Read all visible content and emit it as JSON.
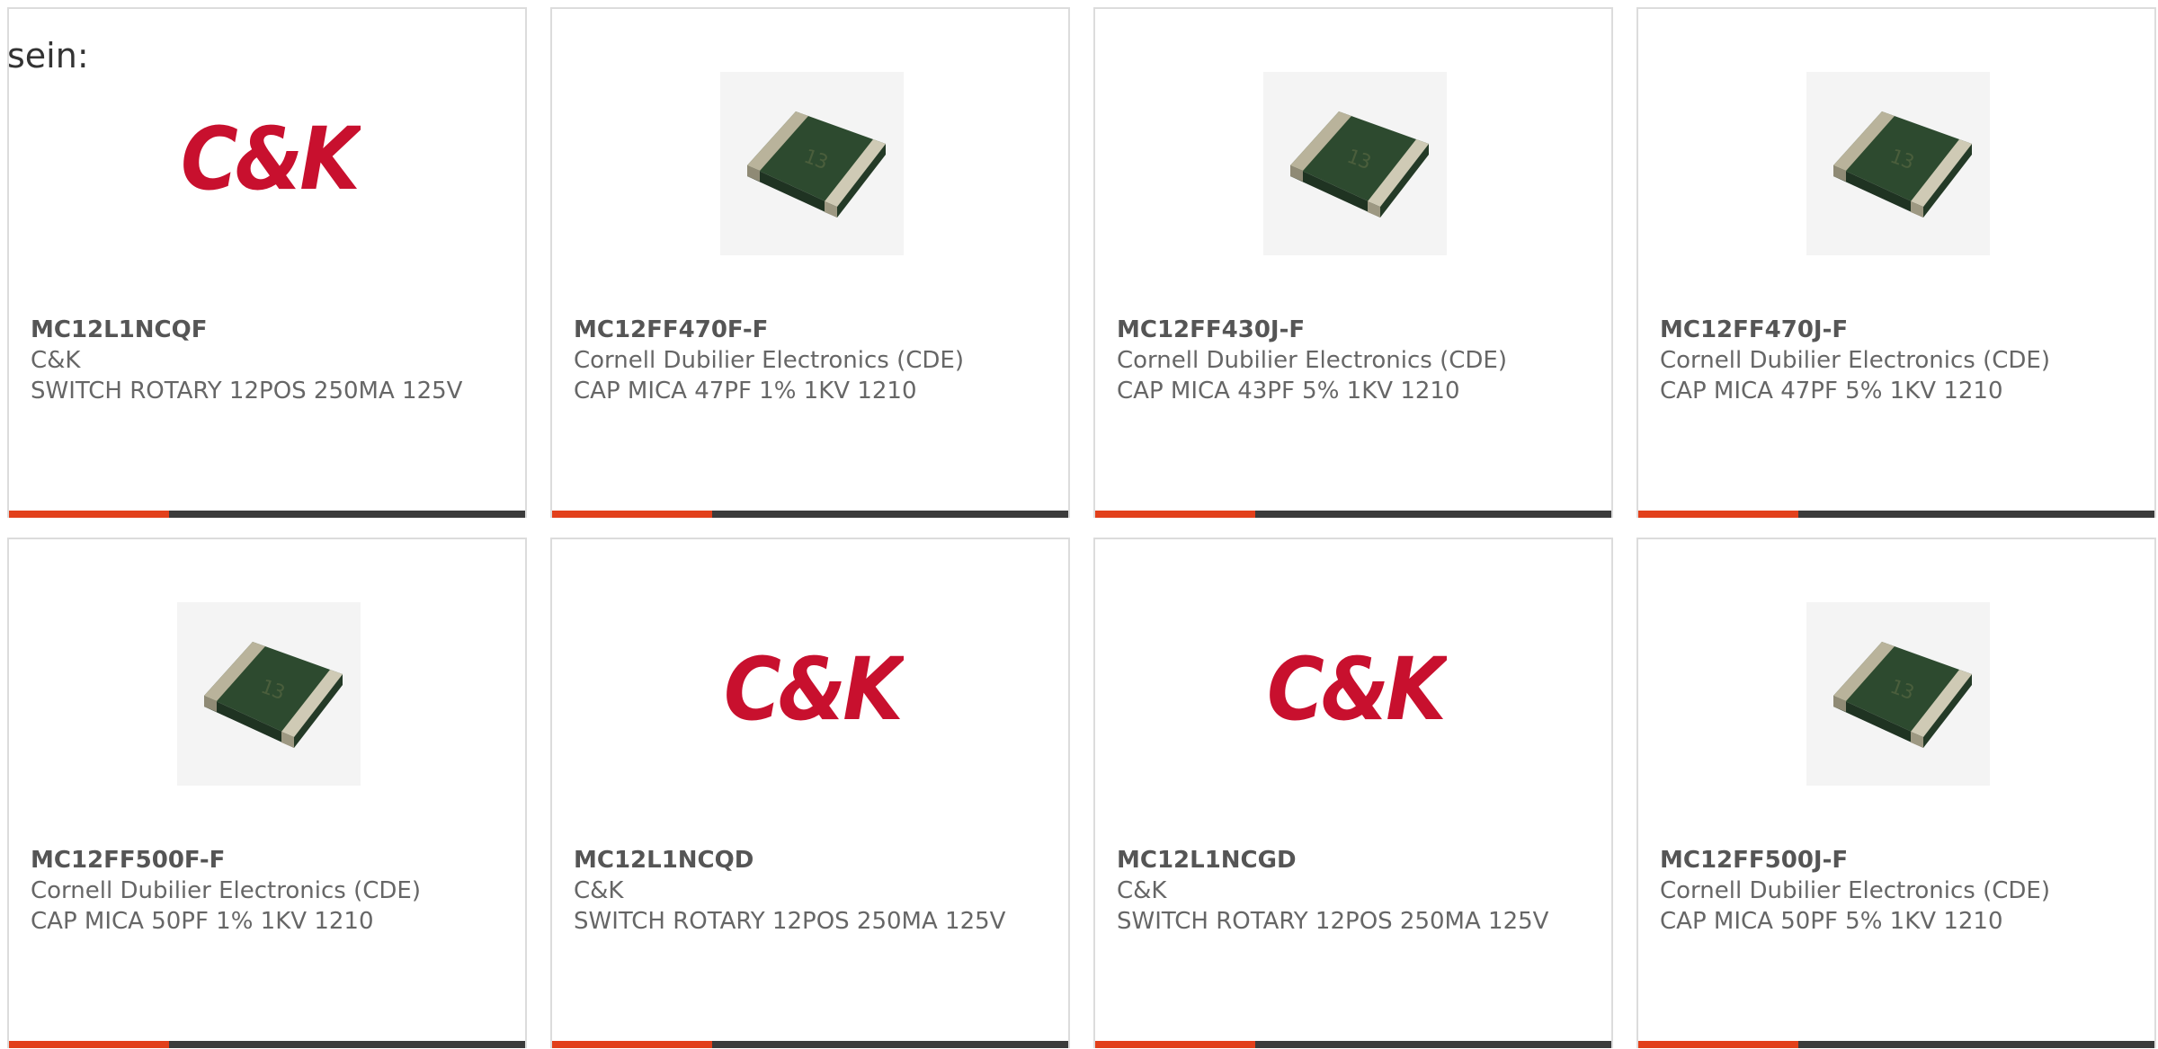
{
  "intro_text": "sein:",
  "colors": {
    "accent": "#e2401b",
    "bar": "#3b3b3b",
    "logo_red": "#c8102e"
  },
  "accent_fraction": 0.31,
  "products": [
    {
      "part": "MC12L1NCQF",
      "manufacturer": "C&K",
      "description": "SWITCH ROTARY 12POS 250MA 125V",
      "image": "ck-logo",
      "logo_text": "C&K"
    },
    {
      "part": "MC12FF470F-F",
      "manufacturer": "Cornell Dubilier Electronics (CDE)",
      "description": "CAP MICA 47PF 1% 1KV 1210",
      "image": "mica-capacitor"
    },
    {
      "part": "MC12FF430J-F",
      "manufacturer": "Cornell Dubilier Electronics (CDE)",
      "description": "CAP MICA 43PF 5% 1KV 1210",
      "image": "mica-capacitor"
    },
    {
      "part": "MC12FF470J-F",
      "manufacturer": "Cornell Dubilier Electronics (CDE)",
      "description": "CAP MICA 47PF 5% 1KV 1210",
      "image": "mica-capacitor"
    },
    {
      "part": "MC12FF500F-F",
      "manufacturer": "Cornell Dubilier Electronics (CDE)",
      "description": "CAP MICA 50PF 1% 1KV 1210",
      "image": "mica-capacitor"
    },
    {
      "part": "MC12L1NCQD",
      "manufacturer": "C&K",
      "description": "SWITCH ROTARY 12POS 250MA 125V",
      "image": "ck-logo",
      "logo_text": "C&K"
    },
    {
      "part": "MC12L1NCGD",
      "manufacturer": "C&K",
      "description": "SWITCH ROTARY 12POS 250MA 125V",
      "image": "ck-logo",
      "logo_text": "C&K"
    },
    {
      "part": "MC12FF500J-F",
      "manufacturer": "Cornell Dubilier Electronics (CDE)",
      "description": "CAP MICA 50PF 5% 1KV 1210",
      "image": "mica-capacitor"
    }
  ]
}
